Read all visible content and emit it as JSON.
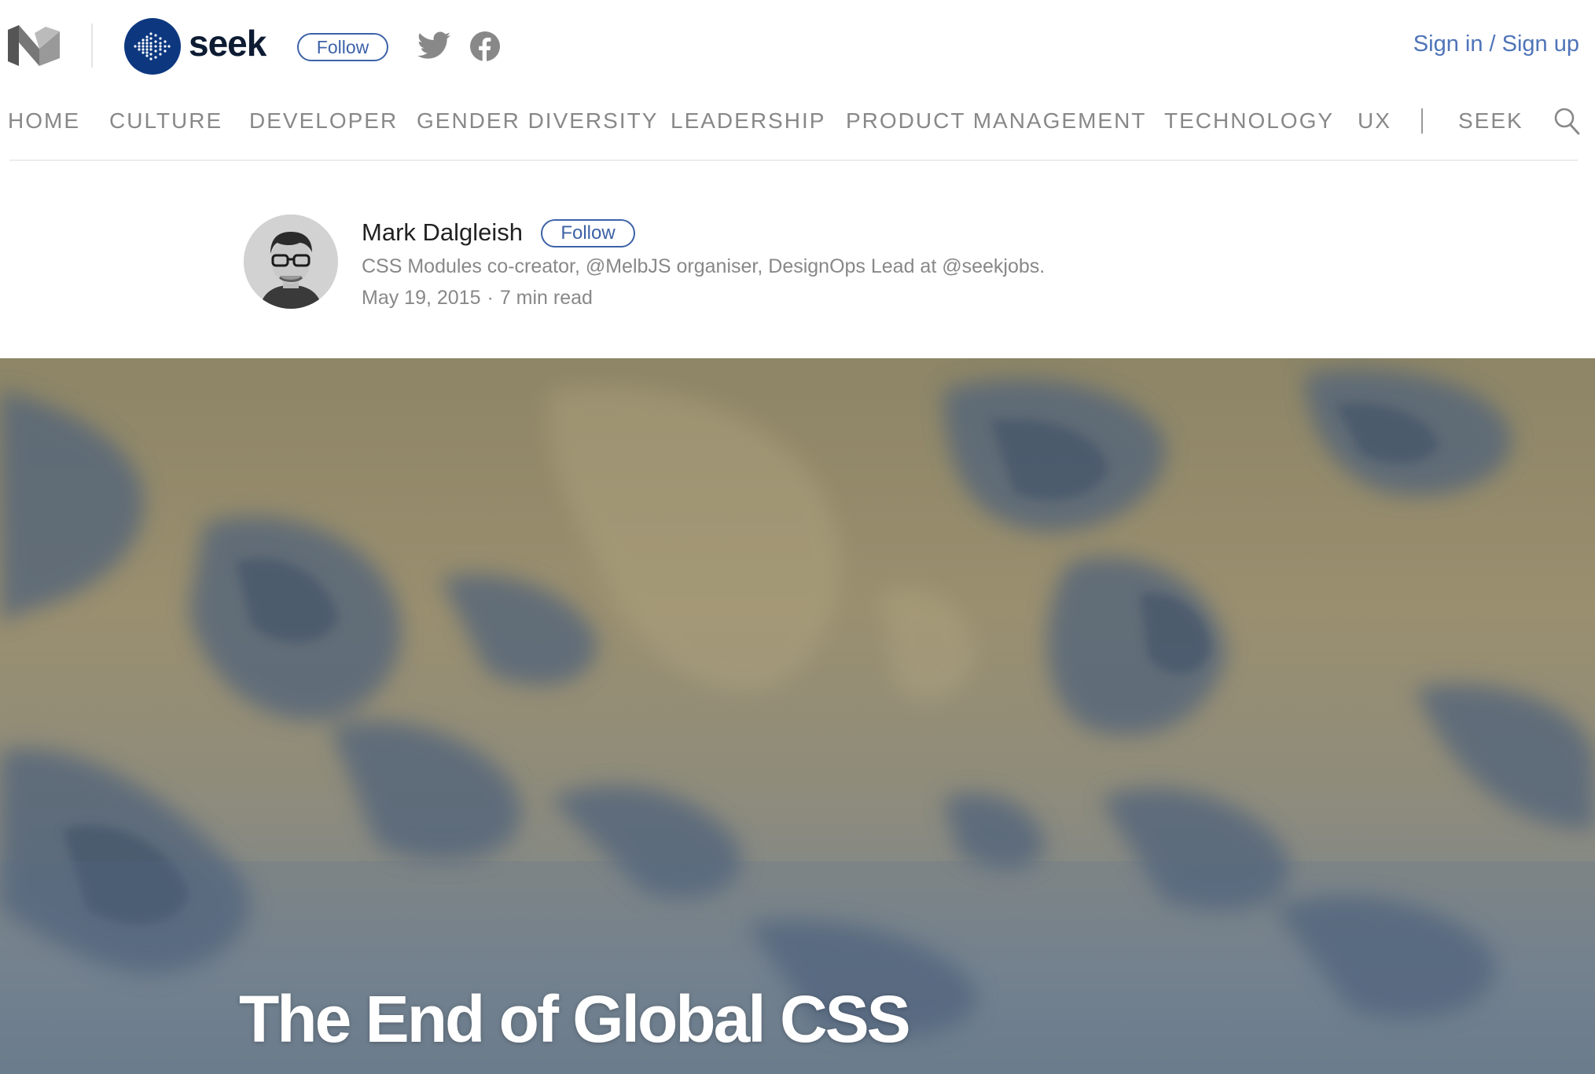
{
  "publication": {
    "name": "seek",
    "follow_label": "Follow",
    "sign_in_label": "Sign in / Sign up"
  },
  "icons": {
    "medium": "medium-logo-icon",
    "seek": "seek-logo-icon",
    "twitter": "twitter-icon",
    "facebook": "facebook-icon",
    "search": "search-icon"
  },
  "nav": {
    "items": [
      "HOME",
      "CULTURE",
      "DEVELOPER",
      "GENDER DIVERSITY",
      "LEADERSHIP",
      "PRODUCT MANAGEMENT",
      "TECHNOLOGY",
      "UX",
      "SEEK"
    ]
  },
  "author": {
    "name": "Mark Dalgleish",
    "follow_label": "Follow",
    "bio": "CSS Modules co-creator, @MelbJS organiser, DesignOps Lead at @seekjobs.",
    "date": "May 19, 2015",
    "separator": "·",
    "read_time": "7 min read"
  },
  "article": {
    "title": "The End of Global CSS"
  },
  "colors": {
    "accent": "#3d62a8",
    "signin": "#4f74b8",
    "seek_blue": "#0d3880",
    "nav_text": "#888888"
  }
}
